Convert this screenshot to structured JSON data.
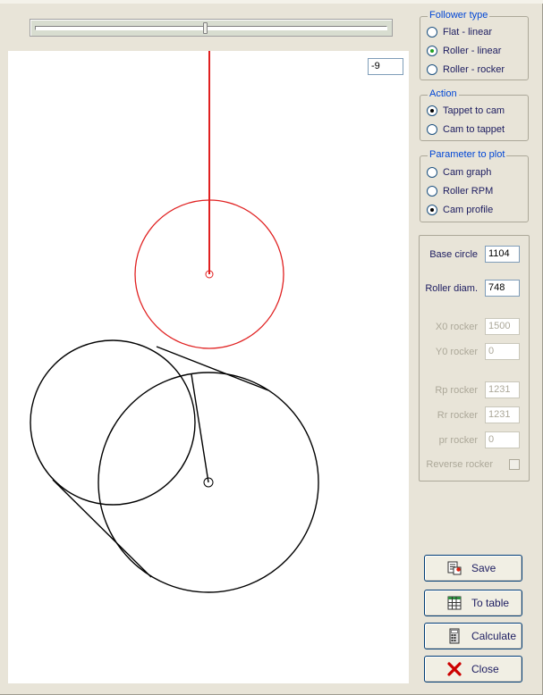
{
  "angle_value": "-9",
  "slider": {
    "position": 0.48
  },
  "follower_type": {
    "title": "Follower type",
    "options": [
      "Flat - linear",
      "Roller - linear",
      "Roller - rocker"
    ],
    "selected": 1
  },
  "action": {
    "title": "Action",
    "options": [
      "Tappet to cam",
      "Cam to tappet"
    ],
    "selected": 0
  },
  "parameter_to_plot": {
    "title": "Parameter to plot",
    "options": [
      "Cam graph",
      "Roller RPM",
      "Cam profile"
    ],
    "selected": 2
  },
  "params": {
    "base_circle": {
      "label": "Base circle",
      "value": "1104"
    },
    "roller_diam": {
      "label": "Roller diam.",
      "value": "748"
    },
    "x0_rocker": {
      "label": "X0 rocker",
      "value": "1500"
    },
    "y0_rocker": {
      "label": "Y0 rocker",
      "value": "0"
    },
    "rp_rocker": {
      "label": "Rp rocker",
      "value": "1231"
    },
    "rr_rocker": {
      "label": "Rr rocker",
      "value": "1231"
    },
    "pr_rocker": {
      "label": "pr rocker",
      "value": "0"
    },
    "reverse_rocker": {
      "label": "Reverse rocker",
      "checked": false
    }
  },
  "buttons": {
    "save": "Save",
    "to_table": "To table",
    "calculate": "Calculate",
    "close": "Close"
  },
  "colors": {
    "follower": "#e02020",
    "cam": "#000000",
    "accent": "#21a121"
  }
}
